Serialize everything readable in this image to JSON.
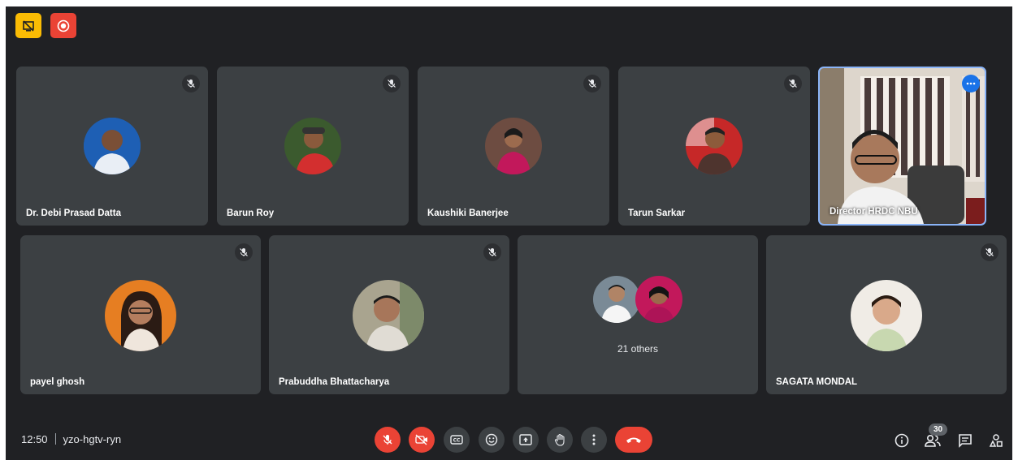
{
  "top_icons": {
    "presenting": "screen-share-off-icon",
    "recording": "record-icon"
  },
  "tiles": [
    {
      "name": "Dr. Debi Prasad Datta"
    },
    {
      "name": "Barun Roy"
    },
    {
      "name": "Kaushiki Banerjee"
    },
    {
      "name": "Tarun Sarkar"
    },
    {
      "name": "Director HRDC NBU"
    },
    {
      "name": "payel ghosh"
    },
    {
      "name": "Prabuddha Bhattacharya"
    },
    {
      "name": "",
      "others": "21 others"
    },
    {
      "name": "SAGATA MONDAL"
    }
  ],
  "meeting": {
    "time": "12:50",
    "code": "yzo-hgtv-ryn"
  },
  "controls": [
    "mic-off-icon",
    "camera-off-icon",
    "captions-icon",
    "emoji-icon",
    "present-icon",
    "raise-hand-icon",
    "more-options-icon",
    "hang-up-icon"
  ],
  "right_panel": {
    "people_count": "30"
  },
  "colors": {
    "bg": "#202124",
    "tile": "#3c4043",
    "red": "#ea4335",
    "blue": "#1a73e8",
    "yellow": "#fbbc04"
  }
}
